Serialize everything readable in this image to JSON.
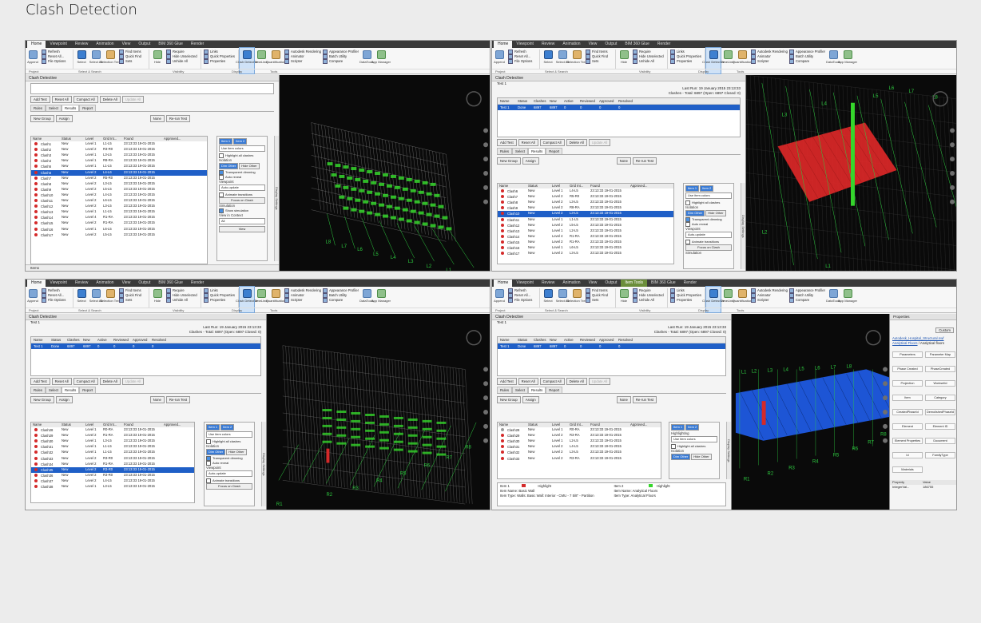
{
  "title": "Clash Detection",
  "ribbon": {
    "tabs": [
      "Home",
      "Viewpoint",
      "Review",
      "Animation",
      "View",
      "Output",
      "BIM 360 Glue",
      "Render"
    ],
    "tabs_alt": [
      "Home",
      "Viewpoint",
      "Review",
      "Animation",
      "View",
      "Output",
      "Item Tools",
      "BIM 360 Glue",
      "Render"
    ],
    "buttons": {
      "append": "Append",
      "select": "Select",
      "select_all": "Select All",
      "selection_tree": "Selection Tree",
      "hide": "Hide",
      "clash_detective": "Clash Detective",
      "timeliner": "TimeLiner",
      "quantification": "Quantification",
      "datatools": "DataTools",
      "app_manager": "App Manager"
    },
    "project_items": [
      "Refresh",
      "Reset All...",
      "File Options"
    ],
    "select_items": [
      "Find Items",
      "Quick Find",
      "Sets"
    ],
    "visibility_items": [
      "Require",
      "Hide Unselected",
      "Unhide All"
    ],
    "display_items": [
      "Links",
      "Quick Properties",
      "Properties"
    ],
    "tools_items": [
      "Autodesk Rendering",
      "Animator",
      "Scripter"
    ],
    "tools_items2": [
      "Appearance Profiler",
      "Batch Utility",
      "Compare"
    ],
    "groups": [
      "Project",
      "Select & Search",
      "Visibility",
      "Display",
      "Tools"
    ]
  },
  "clash_panel": {
    "title": "Clash Detective",
    "test_name": "Test 1",
    "last_run": "Last Run: 19 January 2015 23:13:33",
    "summary": "Clashes - Total: 6897 (Open: 6897  Closed: 0)",
    "test_columns": [
      "Name",
      "Status",
      "Clashes",
      "New",
      "Active",
      "Reviewed",
      "Approved",
      "Resolved"
    ],
    "test_row": [
      "Test 1",
      "Done",
      "6897",
      "6897",
      "0",
      "0",
      "0",
      "0"
    ],
    "buttons": [
      "Add Test",
      "Reset All",
      "Compact All",
      "Delete All",
      "Update All"
    ],
    "subtabs": [
      "Rules",
      "Select",
      "Results",
      "Report"
    ],
    "result_buttons": [
      "New Group",
      "Assign",
      "None",
      "Re-run Test"
    ],
    "result_columns": [
      "Name",
      "Status",
      "Level",
      "Grid Int...",
      "Found",
      "Approved..."
    ],
    "status_new": "New",
    "found": "23:13:33 19-01-2015",
    "items_label": "Items",
    "status_bar": "Items"
  },
  "clashes_a": [
    [
      "Clash1",
      "Level 1",
      "L1-L5"
    ],
    [
      "Clash2",
      "Level 2",
      "R3-R0"
    ],
    [
      "Clash3",
      "Level 1",
      "L3-L5"
    ],
    [
      "Clash4",
      "Level 1",
      "R8-RA"
    ],
    [
      "Clash5",
      "Level 1",
      "L1-L5"
    ],
    [
      "Clash6",
      "Level 2",
      "L4-L6"
    ],
    [
      "Clash7",
      "Level 2",
      "R5-R0"
    ],
    [
      "Clash8",
      "Level 2",
      "L3-L5"
    ],
    [
      "Clash9",
      "Level 2",
      "L5-L5"
    ],
    [
      "Clash10",
      "Level 2",
      "L4-L5"
    ],
    [
      "Clash11",
      "Level 2",
      "L6-L5"
    ],
    [
      "Clash12",
      "Level 2",
      "L3-L5"
    ],
    [
      "Clash13",
      "Level 1",
      "L1-L5"
    ],
    [
      "Clash14",
      "Level 4",
      "R1-RA"
    ],
    [
      "Clash15",
      "Level 2",
      "R1-RA"
    ],
    [
      "Clash16",
      "Level 1",
      "L6-L5"
    ],
    [
      "Clash17",
      "Level 2",
      "L5-L5"
    ]
  ],
  "clashes_b": [
    [
      "Clash6",
      "Level 1",
      "L4-L5"
    ],
    [
      "Clash7",
      "Level 2",
      "R5-R0"
    ],
    [
      "Clash8",
      "Level 2",
      "L3-L5"
    ],
    [
      "Clash9",
      "Level 2",
      "R8-RA"
    ],
    [
      "Clash10",
      "Level 2",
      "L3-L5"
    ],
    [
      "Clash11",
      "Level 1",
      "L1-L5"
    ],
    [
      "Clash12",
      "Level 2",
      "L5-L5"
    ],
    [
      "Clash13",
      "Level 1",
      "L2-L5"
    ],
    [
      "Clash14",
      "Level 4",
      "R1-RA"
    ],
    [
      "Clash15",
      "Level 2",
      "R1-RA"
    ],
    [
      "Clash16",
      "Level 1",
      "L6-L5"
    ],
    [
      "Clash17",
      "Level 2",
      "L3-L5"
    ]
  ],
  "clashes_c": [
    [
      "Clash28",
      "Level 1",
      "R0-RA"
    ],
    [
      "Clash29",
      "Level 2",
      "R1-RA"
    ],
    [
      "Clash30",
      "Level 1",
      "L3-L5"
    ],
    [
      "Clash31",
      "Level 1",
      "L1-L5"
    ],
    [
      "Clash32",
      "Level 1",
      "L1-L5"
    ],
    [
      "Clash33",
      "Level 2",
      "R3-R0"
    ],
    [
      "Clash34",
      "Level 2",
      "R1-RA"
    ],
    [
      "Clash35",
      "Level 2",
      "R3-R0"
    ],
    [
      "Clash36",
      "Level 2",
      "R3-R0"
    ],
    [
      "Clash37",
      "Level 2",
      "L4-L5"
    ],
    [
      "Clash38",
      "Level 1",
      "L3-L5"
    ]
  ],
  "clashes_d": [
    [
      "Clash28",
      "Level 1",
      "R0-RA"
    ],
    [
      "Clash29",
      "Level 2",
      "R3-RA"
    ],
    [
      "Clash30",
      "Level 1",
      "L2-L5"
    ],
    [
      "Clash31",
      "Level 2",
      "L4-L5"
    ],
    [
      "Clash32",
      "Level 2",
      "L3-L5"
    ],
    [
      "Clash33",
      "Level 2",
      "R3-RA"
    ]
  ],
  "side_panel": {
    "items_tabs": [
      "Item 1",
      "Item 2"
    ],
    "highlighting": "Highlighting",
    "use_item_colors": "Use item colors",
    "highlight_all": "Highlight all clashes",
    "isolation": "Isolation",
    "dim_other": "Dim Other",
    "hide_other": "Hide Other",
    "transparent_dimming": "Transparent dimming",
    "auto_reveal": "Auto reveal",
    "viewpoint": "Viewpoint",
    "auto_update": "Auto-update",
    "animate": "Animate transitions",
    "focus": "Focus on Clash",
    "simulation": "Simulation",
    "show_sim": "Show simulation",
    "view_in_context": "View in Context",
    "all": "All",
    "view": "View",
    "display_settings": "Display Settings"
  },
  "grid_labels_a": [
    "L8",
    "L7",
    "L6",
    "L5",
    "L4",
    "L3",
    "L2",
    "L1"
  ],
  "grid_labels_b": [
    "L1",
    "L2",
    "L3",
    "L4",
    "L5",
    "L6",
    "L7",
    "L8"
  ],
  "grid_labels_c": [
    "R1",
    "R2",
    "R3",
    "R4",
    "R5",
    "R6",
    "R7",
    "R8"
  ],
  "grid_labels_d_l": [
    "L1",
    "L2",
    "L3",
    "L4",
    "L5",
    "L6",
    "L7",
    "L8"
  ],
  "grid_labels_d_r": [
    "R1",
    "R2",
    "R3",
    "R4",
    "R5",
    "R6",
    "R7",
    "R8"
  ],
  "item_bar": {
    "item1": "Item 1",
    "item2": "Item 2",
    "highlight": "Highlight",
    "item1_name": "Item Name: Basic Wall",
    "item1_type": "Item Type: Walls: Basic Wall: Interior - CMU - 7 5/8\" - Partition",
    "item2_name": "Item Name: Analytical Floors",
    "item2_type": "Item Type: Analytical Floors"
  },
  "properties": {
    "title": "Properties",
    "custom": "Custom",
    "link1": "Autodesk_Hospital_Structural.nwf",
    "link2": "Analytical Floors",
    "link2_tail": "/ Analytical floors",
    "tags": [
      "Parameters",
      "Parameter Map",
      "Phase Created",
      "PhaseCreated",
      "Projection",
      "WorksetId",
      "Item",
      "Category",
      "CreatedPhaseId",
      "DemolishedPhaseId",
      "Element",
      "Element ID",
      "Element Properties",
      "Document",
      "Id",
      "FamilyType",
      "Materials"
    ],
    "kv_head": [
      "Property",
      "Value"
    ],
    "kv_row": [
      "IntegerVal...",
      "186755"
    ]
  },
  "colors": {
    "selection": "#1f5fc7",
    "clash_green": "#35d62b",
    "clash_red": "#d42a2a",
    "floor_blue": "#1f5ae0"
  }
}
